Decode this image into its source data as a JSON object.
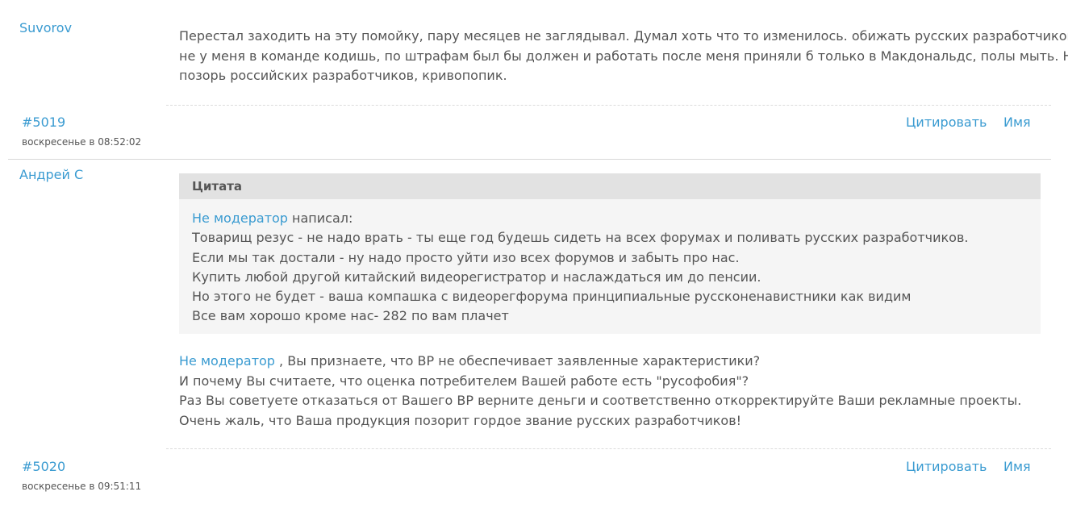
{
  "posts": [
    {
      "author": "Suvorov",
      "body_lines": [
        "Перестал заходить на эту помойку, пару месяцев не заглядывал. Думал хоть что то изменилось. обижать русских разработчиков!",
        "не у меня в команде кодишь, по штрафам был бы должен и работать после меня приняли б только в Макдональдс, полы мыть. Не",
        "позорь российских разработчиков, кривопопик."
      ],
      "number": "#5019",
      "time": "воскресенье в 08:52:02",
      "quote_label": "Цитировать",
      "name_label": "Имя"
    },
    {
      "author": "Андрей С",
      "quote": {
        "title": "Цитата",
        "quoted_user": "Не модератор",
        "wrote": " написал:",
        "lines": [
          "Товарищ резус - не надо врать - ты еще год будешь сидеть на всех форумах и поливать русских разработчиков.",
          "Если мы так достали - ну надо просто уйти изо всех форумов и забыть про нас.",
          "Купить любой другой китайский видеорегистратор и наслаждаться им до пенсии.",
          "Но этого не будет - ваша компашка с видеорегфорума принципиальные руссконенавистники как видим",
          "Все вам хорошо кроме нас- 282 по вам плачет"
        ]
      },
      "reply_to": "Не модератор",
      "reply_first_line": " , Вы признаете, что ВР не обеспечивает заявленные характеристики?",
      "body_lines": [
        "И почему Вы считаете, что оценка потребителем Вашей работе есть \"русофобия\"?",
        "Раз Вы советуете отказаться от Вашего ВР верните деньги и соответственно откорректируйте Ваши рекламные проекты.",
        "Очень жаль, что Ваша продукция позорит гордое звание русских разработчиков!"
      ],
      "number": "#5020",
      "time": "воскресенье в 09:51:11",
      "quote_label": "Цитировать",
      "name_label": "Имя"
    }
  ],
  "colors": {
    "link": "#3a9bd1",
    "text": "#555555",
    "quote_bg": "#f5f5f5",
    "quote_head_bg": "#e2e2e2"
  }
}
